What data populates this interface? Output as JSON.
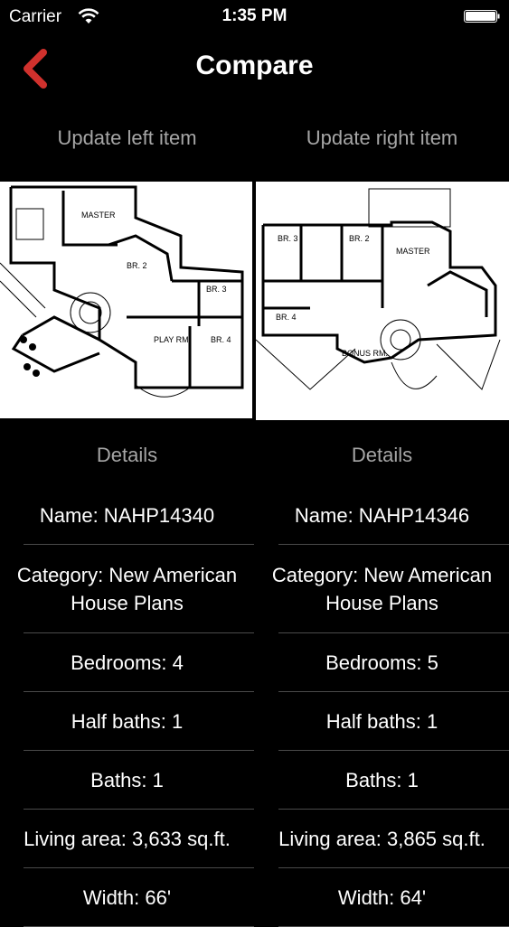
{
  "status_bar": {
    "carrier": "Carrier",
    "time": "1:35 PM"
  },
  "nav": {
    "title": "Compare",
    "back_icon": "chevron-left-icon",
    "accent_color": "#d0312d"
  },
  "update": {
    "left_label": "Update left item",
    "right_label": "Update right item"
  },
  "left": {
    "plan_labels": [
      "MASTER",
      "BR. 2",
      "BR. 3",
      "PLAY RM.",
      "BR. 4"
    ],
    "details_label": "Details",
    "name": "Name: NAHP14340",
    "category": "Category: New American House Plans",
    "bedrooms": "Bedrooms: 4",
    "half_baths": "Half baths: 1",
    "baths": "Baths: 1",
    "living_area": "Living area: 3,633 sq.ft.",
    "width": "Width: 66'"
  },
  "right": {
    "plan_labels": [
      "BR. 3",
      "BR. 2",
      "MASTER",
      "BR. 4",
      "BONUS RM."
    ],
    "details_label": "Details",
    "name": "Name: NAHP14346",
    "category": "Category: New American House Plans",
    "bedrooms": "Bedrooms: 5",
    "half_baths": "Half baths: 1",
    "baths": "Baths: 1",
    "living_area": "Living area: 3,865 sq.ft.",
    "width": "Width: 64'"
  }
}
